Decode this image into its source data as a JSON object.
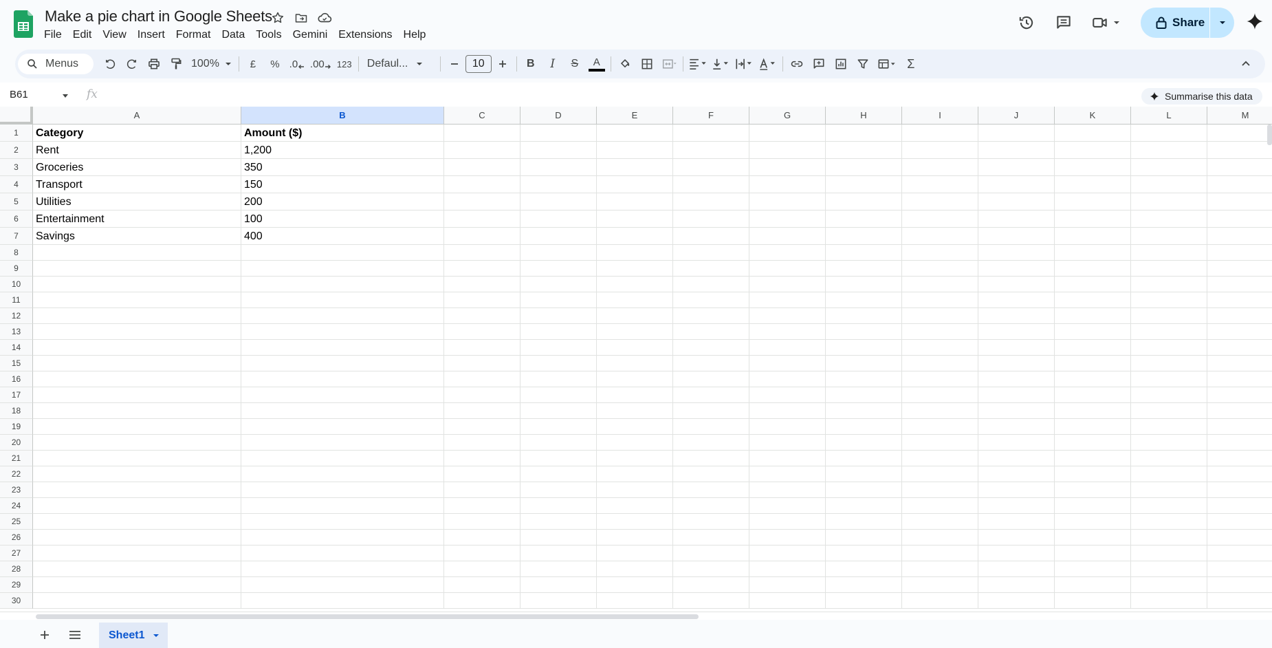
{
  "doc": {
    "title": "Make a pie chart in Google Sheets"
  },
  "menu": [
    "File",
    "Edit",
    "View",
    "Insert",
    "Format",
    "Data",
    "Tools",
    "Gemini",
    "Extensions",
    "Help"
  ],
  "header": {
    "share_label": "Share"
  },
  "toolbar": {
    "search_label": "Menus",
    "zoom": "100%",
    "currency": "£",
    "percent": "%",
    "dec_less": ".0",
    "dec_more": ".00",
    "format_123": "123",
    "font": "Defaul...",
    "font_size": "10",
    "bold": "B",
    "italic": "I",
    "strike": "S",
    "text_color_glyph": "A",
    "sum": "Σ"
  },
  "formula_bar": {
    "name_box": "B61",
    "fx": "fx",
    "summarise": "Summarise this data"
  },
  "grid": {
    "columns": [
      "A",
      "B",
      "C",
      "D",
      "E",
      "F",
      "G",
      "H",
      "I",
      "J",
      "K",
      "L",
      "M"
    ],
    "selected_column": "B",
    "rows": [
      "1",
      "2",
      "3",
      "4",
      "5",
      "6",
      "7",
      "8",
      "9",
      "10",
      "11",
      "12",
      "13",
      "14",
      "15",
      "16",
      "17",
      "18",
      "19",
      "20",
      "21",
      "22",
      "23",
      "24",
      "25",
      "26",
      "27",
      "28",
      "29",
      "30"
    ],
    "data": [
      [
        "Category",
        "Amount ($)"
      ],
      [
        "Rent",
        "1,200"
      ],
      [
        "Groceries",
        "350"
      ],
      [
        "Transport",
        "150"
      ],
      [
        "Utilities",
        "200"
      ],
      [
        "Entertainment",
        "100"
      ],
      [
        "Savings",
        "400"
      ]
    ]
  },
  "sheets": [
    {
      "name": "Sheet1",
      "active": true
    }
  ],
  "colors": {
    "accent": "#0b57d0",
    "share_bg": "#c2e7ff",
    "sheets_green": "#1ea362",
    "toolbar_bg": "#edf2fa"
  }
}
